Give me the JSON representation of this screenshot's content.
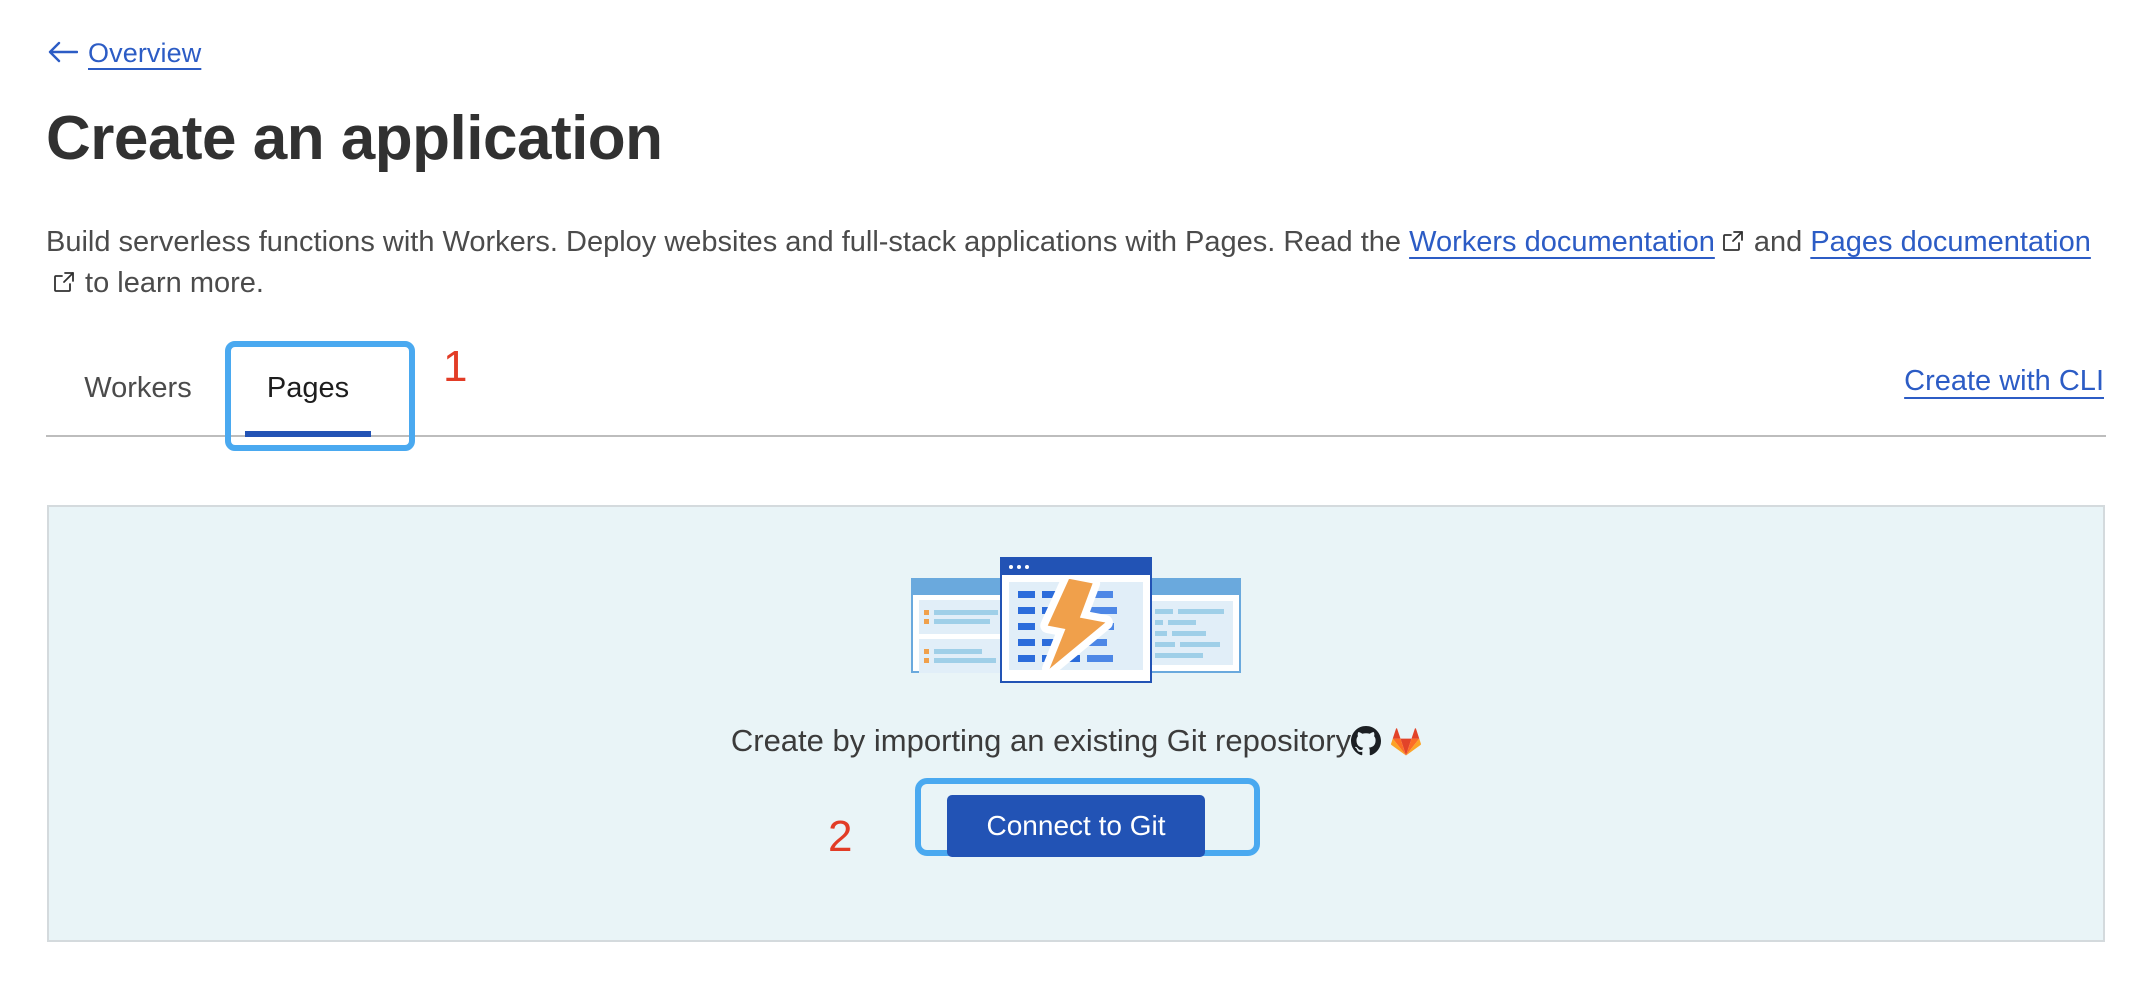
{
  "back_link": {
    "label": "Overview",
    "icon": "left-arrow-icon"
  },
  "page_title": "Create an application",
  "description": {
    "part1": "Build serverless functions with Workers. Deploy websites and full-stack applications with Pages. Read the ",
    "link_workers": "Workers documentation",
    "part2": " and ",
    "link_pages": "Pages documentation",
    "part3": " to learn more.",
    "external_icon": "external-link-icon"
  },
  "tabs": {
    "items": [
      {
        "label": "Workers",
        "active": false
      },
      {
        "label": "Pages",
        "active": true
      }
    ],
    "cli_link": "Create with CLI"
  },
  "annotations": [
    {
      "number": "1",
      "target": "pages-tab",
      "color": "#e23c26"
    },
    {
      "number": "2",
      "target": "connect-to-git-button",
      "color": "#e23c26"
    }
  ],
  "card": {
    "illustration": "browser-windows-lightning-bolt-illustration",
    "caption": "Create by importing an existing Git repository",
    "caption_icons": [
      "github-icon",
      "gitlab-icon"
    ],
    "connect_button": "Connect to Git"
  },
  "colors": {
    "link": "#2c5cc5",
    "accent_blue": "#2253b5",
    "card_background": "#e9f4f7",
    "card_border": "#d4dadd",
    "annotation_box": "#4aa9f0",
    "annotation_number": "#e23c26",
    "bolt_orange": "#f0a04b"
  }
}
